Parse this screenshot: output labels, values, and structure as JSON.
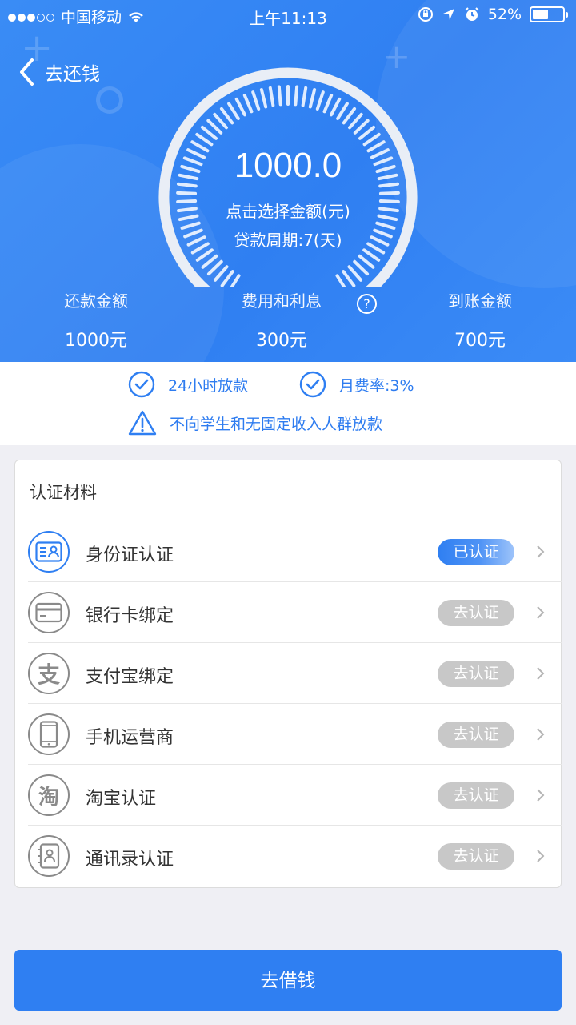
{
  "status_bar": {
    "carrier": "中国移动",
    "time": "上午11:13",
    "battery": "52%",
    "battery_level": 0.52
  },
  "header": {
    "back_label": "去还钱"
  },
  "gauge": {
    "amount": "1000.0",
    "hint": "点击选择金额(元)",
    "period": "贷款周期:7(天)",
    "level": 1.0
  },
  "stats": [
    {
      "label": "还款金额",
      "value": "1000元"
    },
    {
      "label": "费用和利息",
      "value": "300元"
    },
    {
      "label": "到账金额",
      "value": "700元"
    }
  ],
  "help_icon_glyph": "?",
  "notices": {
    "fast_loan": "24小时放款",
    "monthly_rate": "月费率:3%",
    "warning": "不向学生和无固定收入人群放款"
  },
  "verification": {
    "title": "认证材料",
    "items": [
      {
        "label": "身份证认证",
        "status": "已认证",
        "icon": "id-card-icon",
        "done": true
      },
      {
        "label": "银行卡绑定",
        "status": "去认证",
        "icon": "bank-card-icon",
        "done": false
      },
      {
        "label": "支付宝绑定",
        "status": "去认证",
        "icon": "alipay-icon",
        "done": false
      },
      {
        "label": "手机运营商",
        "status": "去认证",
        "icon": "mobile-phone-icon",
        "done": false
      },
      {
        "label": "淘宝认证",
        "status": "去认证",
        "icon": "taobao-icon",
        "done": false
      },
      {
        "label": "通讯录认证",
        "status": "去认证",
        "icon": "contacts-icon",
        "done": false
      }
    ]
  },
  "icon_text": {
    "alipay": "支",
    "taobao": "淘"
  },
  "submit_label": "去借钱",
  "colors": {
    "primary": "#2f7ff2",
    "inactive_badge": "#c8c8c8",
    "text": "#333333"
  }
}
